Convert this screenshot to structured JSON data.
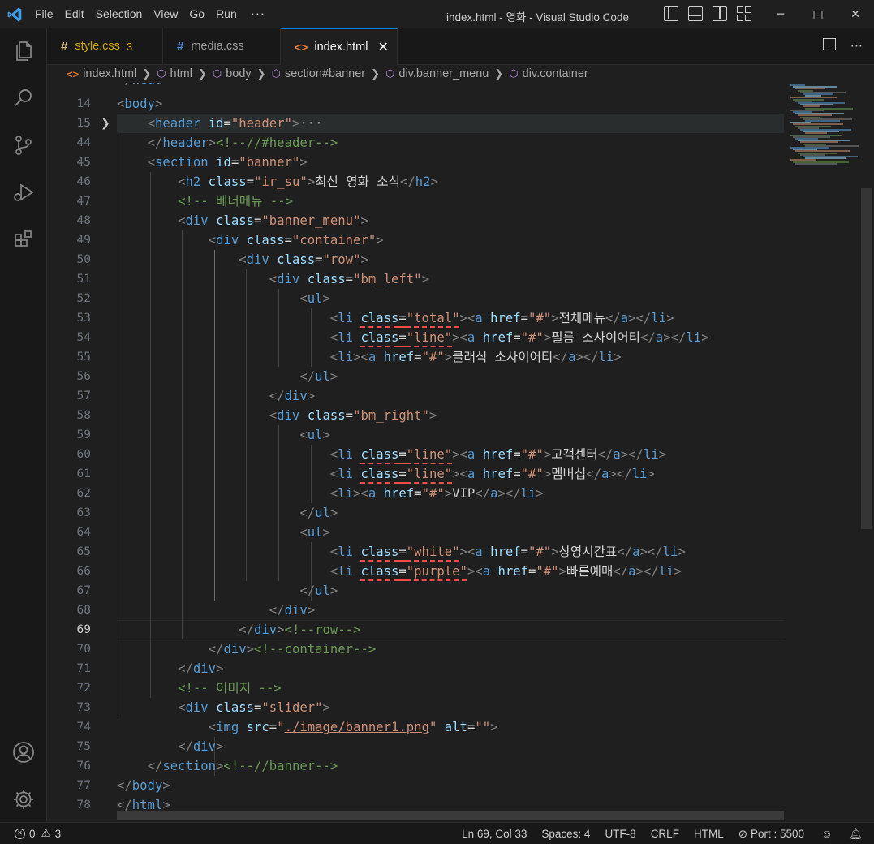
{
  "window": {
    "title": "index.html - 영화 - Visual Studio Code",
    "menu": [
      "File",
      "Edit",
      "Selection",
      "View",
      "Go",
      "Run"
    ],
    "menu_more": "···"
  },
  "tabs": [
    {
      "name": "style.css",
      "badge": "3",
      "icon": "css-hash-icon",
      "active": false,
      "warning": true
    },
    {
      "name": "media.css",
      "badge": "",
      "icon": "css-hash-icon",
      "active": false,
      "warning": false
    },
    {
      "name": "index.html",
      "badge": "",
      "icon": "html-icon",
      "active": true,
      "warning": false
    }
  ],
  "breadcrumb": [
    "index.html",
    "html",
    "body",
    "section#banner",
    "div.banner_menu",
    "div.container"
  ],
  "editor": {
    "first_partial_line": "13",
    "current_line": "69",
    "lines": [
      {
        "n": "14",
        "html": "<span class='t'>&lt;</span><span class='tag'>body</span><span class='t'>&gt;</span>"
      },
      {
        "n": "15",
        "html": "    <span class='t'>&lt;</span><span class='tag'>header</span> <span class='attr'>id</span><span class='txt'>=</span><span class='str'>\"header\"</span><span class='t'>&gt;</span><span class='ell'>···</span>"
      },
      {
        "n": "44",
        "html": "    <span class='t'>&lt;/</span><span class='tag'>header</span><span class='t'>&gt;</span><span class='cm'>&lt;!--//#header--&gt;</span>"
      },
      {
        "n": "45",
        "html": "    <span class='t'>&lt;</span><span class='tag'>section</span> <span class='attr'>id</span><span class='txt'>=</span><span class='str'>\"banner\"</span><span class='t'>&gt;</span>"
      },
      {
        "n": "46",
        "html": "        <span class='t'>&lt;</span><span class='tag'>h2</span> <span class='attr'>class</span><span class='txt'>=</span><span class='str'>\"ir_su\"</span><span class='t'>&gt;</span><span class='txt'>최신 영화 소식</span><span class='t'>&lt;/</span><span class='tag'>h2</span><span class='t'>&gt;</span>"
      },
      {
        "n": "47",
        "html": "        <span class='cm'>&lt;!-- 베너메뉴 --&gt;</span>"
      },
      {
        "n": "48",
        "html": "        <span class='t'>&lt;</span><span class='tag'>div</span> <span class='attr'>class</span><span class='txt'>=</span><span class='str'>\"banner_menu\"</span><span class='t'>&gt;</span>"
      },
      {
        "n": "49",
        "html": "            <span class='t'>&lt;</span><span class='tag'>div</span> <span class='attr'>class</span><span class='txt'>=</span><span class='str'>\"container\"</span><span class='t'>&gt;</span>"
      },
      {
        "n": "50",
        "html": "                <span class='t'>&lt;</span><span class='tag'>div</span> <span class='attr'>class</span><span class='txt'>=</span><span class='str'>\"row\"</span><span class='t'>&gt;</span>"
      },
      {
        "n": "51",
        "html": "                    <span class='t'>&lt;</span><span class='tag'>div</span> <span class='attr'>class</span><span class='txt'>=</span><span class='str'>\"bm_left\"</span><span class='t'>&gt;</span>"
      },
      {
        "n": "52",
        "html": "                        <span class='t'>&lt;</span><span class='tag'>ul</span><span class='t'>&gt;</span>"
      },
      {
        "n": "53",
        "html": "                            <span class='t'>&lt;</span><span class='tag'>li</span> <span class='squig'><span class='attr'>class</span><span class='txt'>=</span><span class='str'>\"total\"</span></span><span class='t'>&gt;&lt;</span><span class='tag'>a</span> <span class='attr'>href</span><span class='txt'>=</span><span class='str'>\"#\"</span><span class='t'>&gt;</span><span class='txt'>전체메뉴</span><span class='t'>&lt;/</span><span class='tag'>a</span><span class='t'>&gt;&lt;/</span><span class='tag'>li</span><span class='t'>&gt;</span>"
      },
      {
        "n": "54",
        "html": "                            <span class='t'>&lt;</span><span class='tag'>li</span> <span class='squig'><span class='attr'>class</span><span class='txt'>=</span><span class='str'>\"line\"</span></span><span class='t'>&gt;&lt;</span><span class='tag'>a</span> <span class='attr'>href</span><span class='txt'>=</span><span class='str'>\"#\"</span><span class='t'>&gt;</span><span class='txt'>필름 소사이어티</span><span class='t'>&lt;/</span><span class='tag'>a</span><span class='t'>&gt;&lt;/</span><span class='tag'>li</span><span class='t'>&gt;</span>"
      },
      {
        "n": "55",
        "html": "                            <span class='t'>&lt;</span><span class='tag'>li</span><span class='t'>&gt;&lt;</span><span class='tag'>a</span> <span class='attr'>href</span><span class='txt'>=</span><span class='str'>\"#\"</span><span class='t'>&gt;</span><span class='txt'>클래식 소사이어티</span><span class='t'>&lt;/</span><span class='tag'>a</span><span class='t'>&gt;&lt;/</span><span class='tag'>li</span><span class='t'>&gt;</span>"
      },
      {
        "n": "56",
        "html": "                        <span class='t'>&lt;/</span><span class='tag'>ul</span><span class='t'>&gt;</span>"
      },
      {
        "n": "57",
        "html": "                    <span class='t'>&lt;/</span><span class='tag'>div</span><span class='t'>&gt;</span>"
      },
      {
        "n": "58",
        "html": "                    <span class='t'>&lt;</span><span class='tag'>div</span> <span class='attr'>class</span><span class='txt'>=</span><span class='str'>\"bm_right\"</span><span class='t'>&gt;</span>"
      },
      {
        "n": "59",
        "html": "                        <span class='t'>&lt;</span><span class='tag'>ul</span><span class='t'>&gt;</span>"
      },
      {
        "n": "60",
        "html": "                            <span class='t'>&lt;</span><span class='tag'>li</span> <span class='squig'><span class='attr'>class</span><span class='txt'>=</span><span class='str'>\"line\"</span></span><span class='t'>&gt;&lt;</span><span class='tag'>a</span> <span class='attr'>href</span><span class='txt'>=</span><span class='str'>\"#\"</span><span class='t'>&gt;</span><span class='txt'>고객센터</span><span class='t'>&lt;/</span><span class='tag'>a</span><span class='t'>&gt;&lt;/</span><span class='tag'>li</span><span class='t'>&gt;</span>"
      },
      {
        "n": "61",
        "html": "                            <span class='t'>&lt;</span><span class='tag'>li</span> <span class='squig'><span class='attr'>class</span><span class='txt'>=</span><span class='str'>\"line\"</span></span><span class='t'>&gt;&lt;</span><span class='tag'>a</span> <span class='attr'>href</span><span class='txt'>=</span><span class='str'>\"#\"</span><span class='t'>&gt;</span><span class='txt'>멤버십</span><span class='t'>&lt;/</span><span class='tag'>a</span><span class='t'>&gt;&lt;/</span><span class='tag'>li</span><span class='t'>&gt;</span>"
      },
      {
        "n": "62",
        "html": "                            <span class='t'>&lt;</span><span class='tag'>li</span><span class='t'>&gt;&lt;</span><span class='tag'>a</span> <span class='attr'>href</span><span class='txt'>=</span><span class='str'>\"#\"</span><span class='t'>&gt;</span><span class='txt'>VIP</span><span class='t'>&lt;/</span><span class='tag'>a</span><span class='t'>&gt;&lt;/</span><span class='tag'>li</span><span class='t'>&gt;</span>"
      },
      {
        "n": "63",
        "html": "                        <span class='t'>&lt;/</span><span class='tag'>ul</span><span class='t'>&gt;</span>"
      },
      {
        "n": "64",
        "html": "                        <span class='t'>&lt;</span><span class='tag'>ul</span><span class='t'>&gt;</span>"
      },
      {
        "n": "65",
        "html": "                            <span class='t'>&lt;</span><span class='tag'>li</span> <span class='squig'><span class='attr'>class</span><span class='txt'>=</span><span class='str'>\"white\"</span></span><span class='t'>&gt;&lt;</span><span class='tag'>a</span> <span class='attr'>href</span><span class='txt'>=</span><span class='str'>\"#\"</span><span class='t'>&gt;</span><span class='txt'>상영시간표</span><span class='t'>&lt;/</span><span class='tag'>a</span><span class='t'>&gt;&lt;/</span><span class='tag'>li</span><span class='t'>&gt;</span>"
      },
      {
        "n": "66",
        "html": "                            <span class='t'>&lt;</span><span class='tag'>li</span> <span class='squig'><span class='attr'>class</span><span class='txt'>=</span><span class='str'>\"purple\"</span></span><span class='t'>&gt;&lt;</span><span class='tag'>a</span> <span class='attr'>href</span><span class='txt'>=</span><span class='str'>\"#\"</span><span class='t'>&gt;</span><span class='txt'>빠른예매</span><span class='t'>&lt;/</span><span class='tag'>a</span><span class='t'>&gt;&lt;/</span><span class='tag'>li</span><span class='t'>&gt;</span>"
      },
      {
        "n": "67",
        "html": "                        <span class='t'>&lt;/</span><span class='tag'>ul</span><span class='t'>&gt;</span>"
      },
      {
        "n": "68",
        "html": "                    <span class='t'>&lt;/</span><span class='tag'>div</span><span class='t'>&gt;</span>"
      },
      {
        "n": "69",
        "html": "                <span class='t'>&lt;/</span><span class='tag'>div</span><span class='t'>&gt;</span><span class='cm'>&lt;!--row--&gt;</span>"
      },
      {
        "n": "70",
        "html": "            <span class='t'>&lt;/</span><span class='tag'>div</span><span class='t'>&gt;</span><span class='cm'>&lt;!--container--&gt;</span>"
      },
      {
        "n": "71",
        "html": "        <span class='t'>&lt;/</span><span class='tag'>div</span><span class='t'>&gt;</span>"
      },
      {
        "n": "72",
        "html": "        <span class='cm'>&lt;!-- 이미지 --&gt;</span>"
      },
      {
        "n": "73",
        "html": "        <span class='t'>&lt;</span><span class='tag'>div</span> <span class='attr'>class</span><span class='txt'>=</span><span class='str'>\"slider\"</span><span class='t'>&gt;</span>"
      },
      {
        "n": "74",
        "html": "            <span class='t'>&lt;</span><span class='tag'>img</span> <span class='attr'>src</span><span class='txt'>=</span><span class='str'>\"<span class='link'>./image/banner1.png</span>\"</span> <span class='attr'>alt</span><span class='txt'>=</span><span class='str'>\"\"</span><span class='t'>&gt;</span>"
      },
      {
        "n": "75",
        "html": "        <span class='t'>&lt;/</span><span class='tag'>div</span><span class='t'>&gt;</span>"
      },
      {
        "n": "76",
        "html": "    <span class='t'>&lt;/</span><span class='tag'>section</span><span class='t'>&gt;</span><span class='cm'>&lt;!--//banner--&gt;</span>"
      },
      {
        "n": "77",
        "html": "<span class='t'>&lt;/</span><span class='tag'>body</span><span class='t'>&gt;</span>"
      },
      {
        "n": "78",
        "html": "<span class='t'>&lt;/</span><span class='tag'>html</span><span class='t'>&gt;</span>"
      }
    ]
  },
  "statusbar": {
    "errors": "0",
    "warnings": "3",
    "position": "Ln 69, Col 33",
    "spaces": "Spaces: 4",
    "encoding": "UTF-8",
    "eol": "CRLF",
    "language": "HTML",
    "port": "Port : 5500"
  },
  "colors": {
    "accent": "#0078d4",
    "tag": "#569cd6",
    "attr": "#9cdcfe",
    "string": "#ce9178",
    "comment": "#6a9955",
    "error_squiggle": "#f14c4c"
  }
}
